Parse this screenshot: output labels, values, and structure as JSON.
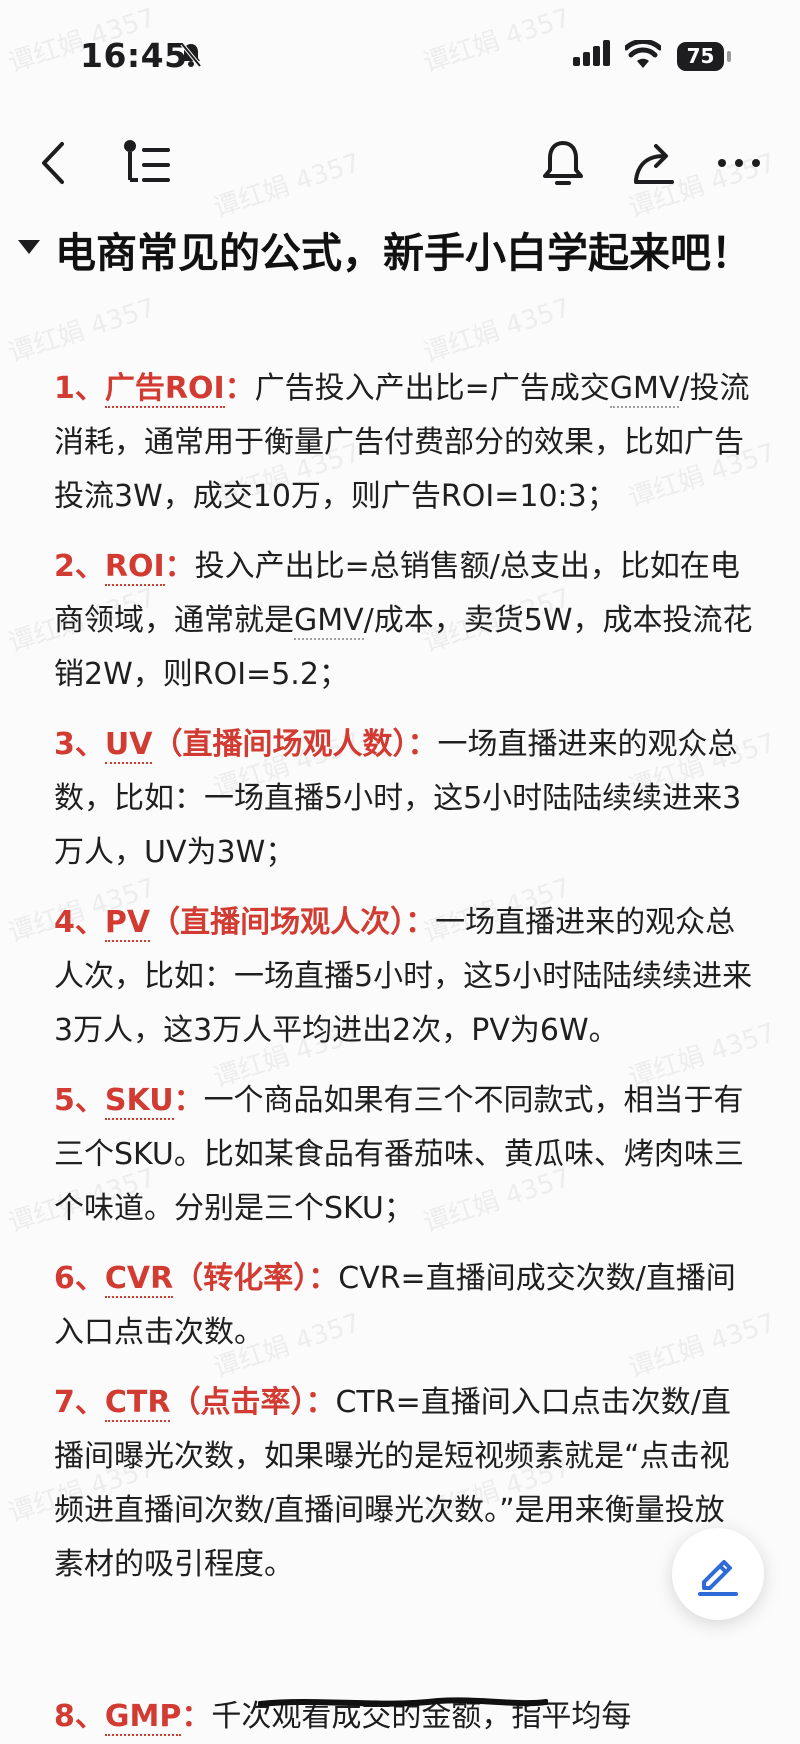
{
  "status_bar": {
    "time": "16:45",
    "battery": "75"
  },
  "nav": {
    "icons": [
      "back-icon",
      "outline-icon",
      "bell-icon",
      "share-icon",
      "more-icon"
    ]
  },
  "title": "电商常见的公式，新手小白学起来吧！",
  "watermark": "谭红娟 4357",
  "items": [
    {
      "num": "1、",
      "term": "广告ROI",
      "extra": "",
      "colon": "：",
      "pre": "广告投入产出比=广告成交",
      "underlined": "GMV",
      "post": "/投流消耗，通常用于衡量广告付费部分的效果，比如广告投流3W，成交10万，则广告ROI=10:3；"
    },
    {
      "num": "2、",
      "term": "ROI",
      "extra": "",
      "colon": "：",
      "pre": "投入产出比=总销售额/总支出，比如在电商领域，通常就是",
      "underlined": "GMV",
      "post": "/成本，卖货5W，成本投流花销2W，则ROI=5.2；"
    },
    {
      "num": "3、",
      "term": "UV",
      "extra": "（直播间场观人数）",
      "colon": "：",
      "pre": "一场直播进来的观众总数，比如：一场直播5小时，这5小时陆陆续续进来3万人，UV为3W；",
      "underlined": "",
      "post": ""
    },
    {
      "num": "4、",
      "term": "PV",
      "extra": "（直播间场观人次）",
      "colon": "：",
      "pre": "一场直播进来的观众总人次，比如：一场直播5小时，这5小时陆陆续续进来3万人，这3万人平均进出2次，PV为6W。",
      "underlined": "",
      "post": ""
    },
    {
      "num": "5、",
      "term": "SKU",
      "extra": "",
      "colon": "：",
      "pre": "一个商品如果有三个不同款式，相当于有三个SKU。比如某食品有番茄味、黄瓜味、烤肉味三个味道。分别是三个SKU；",
      "underlined": "",
      "post": ""
    },
    {
      "num": "6、",
      "term": "CVR",
      "extra": "（转化率）",
      "colon": "：",
      "pre": "CVR=直播间成交次数/直播间入口点击次数。",
      "underlined": "",
      "post": ""
    },
    {
      "num": "7、",
      "term": "CTR",
      "extra": "（点击率）",
      "colon": "：",
      "pre": "CTR=直播间入口点击次数/直播间曝光次数，如果曝光的是短视频素就是“点击视频进直播间次数/直播间曝光次数。”是用来衡量投放素材的吸引程度。",
      "underlined": "",
      "post": ""
    }
  ],
  "last_item": {
    "num": "8、",
    "term": "GMP",
    "colon": "：",
    "text": "千次观看成交的金额，指平均每"
  },
  "fab": {
    "icon": "edit-icon"
  }
}
